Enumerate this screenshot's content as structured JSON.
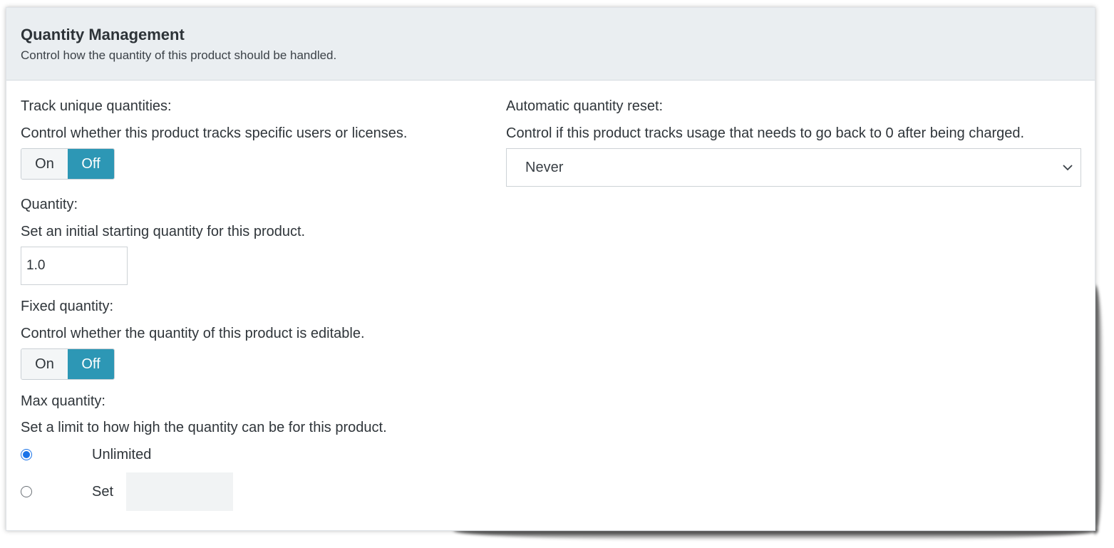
{
  "header": {
    "title": "Quantity Management",
    "subtitle": "Control how the quantity of this product should be handled."
  },
  "track_unique": {
    "label": "Track unique quantities:",
    "description": "Control whether this product tracks specific users or licenses.",
    "on_label": "On",
    "off_label": "Off",
    "selected": "Off"
  },
  "quantity": {
    "label": "Quantity:",
    "description": "Set an initial starting quantity for this product.",
    "value": "1.0"
  },
  "fixed_quantity": {
    "label": "Fixed quantity:",
    "description": "Control whether the quantity of this product is editable.",
    "on_label": "On",
    "off_label": "Off",
    "selected": "Off"
  },
  "max_quantity": {
    "label": "Max quantity:",
    "description": "Set a limit to how high the quantity can be for this product.",
    "options": [
      "Unlimited",
      "Set"
    ],
    "selected": "Unlimited",
    "set_value": ""
  },
  "auto_reset": {
    "label": "Automatic quantity reset:",
    "description": "Control if this product tracks usage that needs to go back to 0 after being charged.",
    "selected_value": "Never",
    "icon": "chevron-down-icon"
  },
  "colors": {
    "header_bg": "#eaeef1",
    "toggle_active": "#2d97b5",
    "radio_accent": "#1a73e8"
  }
}
